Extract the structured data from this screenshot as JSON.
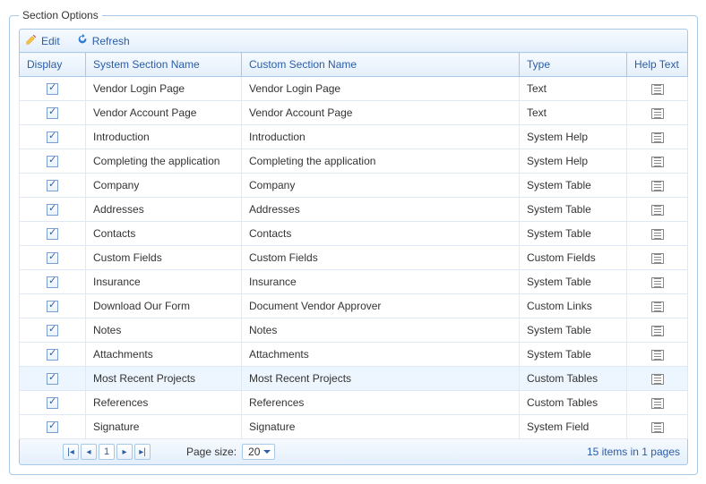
{
  "panel": {
    "legend": "Section Options"
  },
  "toolbar": {
    "edit": "Edit",
    "refresh": "Refresh"
  },
  "columns": {
    "display": "Display",
    "system": "System Section Name",
    "custom": "Custom Section Name",
    "type": "Type",
    "help": "Help Text"
  },
  "pager": {
    "page_size_label": "Page size:",
    "page_size_value": "20",
    "current_page": "1",
    "status": "15 items in 1 pages"
  },
  "rows": [
    {
      "display": true,
      "system": "Vendor Login Page",
      "custom": "Vendor Login Page",
      "type": "Text",
      "selected": false
    },
    {
      "display": true,
      "system": "Vendor Account Page",
      "custom": "Vendor Account Page",
      "type": "Text",
      "selected": false
    },
    {
      "display": true,
      "system": "Introduction",
      "custom": "Introduction",
      "type": "System Help",
      "selected": false
    },
    {
      "display": true,
      "system": "Completing the application",
      "custom": "Completing the application",
      "type": "System Help",
      "selected": false
    },
    {
      "display": true,
      "system": "Company",
      "custom": "Company",
      "type": "System Table",
      "selected": false
    },
    {
      "display": true,
      "system": "Addresses",
      "custom": "Addresses",
      "type": "System Table",
      "selected": false
    },
    {
      "display": true,
      "system": "Contacts",
      "custom": "Contacts",
      "type": "System Table",
      "selected": false
    },
    {
      "display": true,
      "system": "Custom Fields",
      "custom": "Custom Fields",
      "type": "Custom Fields",
      "selected": false
    },
    {
      "display": true,
      "system": "Insurance",
      "custom": "Insurance",
      "type": "System Table",
      "selected": false
    },
    {
      "display": true,
      "system": "Download Our Form",
      "custom": "Document Vendor Approver",
      "type": "Custom Links",
      "selected": false
    },
    {
      "display": true,
      "system": "Notes",
      "custom": "Notes",
      "type": "System Table",
      "selected": false
    },
    {
      "display": true,
      "system": "Attachments",
      "custom": "Attachments",
      "type": "System Table",
      "selected": false
    },
    {
      "display": true,
      "system": "Most Recent Projects",
      "custom": "Most Recent Projects",
      "type": "Custom Tables",
      "selected": true
    },
    {
      "display": true,
      "system": "References",
      "custom": "References",
      "type": "Custom Tables",
      "selected": false
    },
    {
      "display": true,
      "system": "Signature",
      "custom": "Signature",
      "type": "System Field",
      "selected": false
    }
  ]
}
